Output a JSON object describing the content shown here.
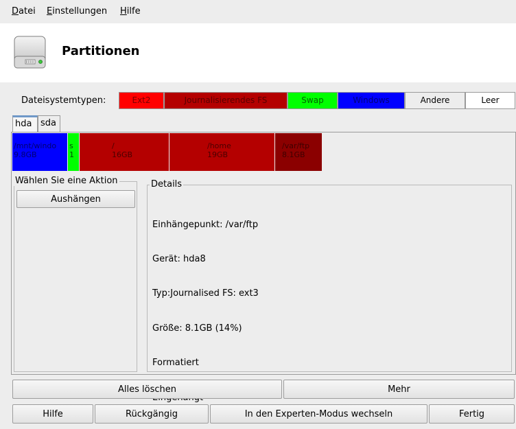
{
  "menu": [
    {
      "mnemonic": "D",
      "rest": "atei"
    },
    {
      "mnemonic": "E",
      "rest": "instellungen"
    },
    {
      "mnemonic": "H",
      "rest": "ilfe"
    }
  ],
  "header": {
    "title": "Partitionen",
    "icon": "hard-disk-icon"
  },
  "legend": {
    "label": "Dateisystemtypen:",
    "items": [
      {
        "label": "Ext2",
        "color": "#ff0000",
        "text_color": "#7a0000"
      },
      {
        "label": "Journalisierendes FS",
        "color": "#b40000",
        "text_color": "#5a0000"
      },
      {
        "label": "Swap",
        "color": "#00ff00",
        "text_color": "#006400"
      },
      {
        "label": "Windows",
        "color": "#0000ff",
        "text_color": "#00007a"
      },
      {
        "label": "Andere",
        "color": "#ededed",
        "text_color": "#000000"
      },
      {
        "label": "Leer",
        "color": "#ffffff",
        "text_color": "#000000"
      }
    ]
  },
  "tabs": [
    {
      "label": "hda",
      "active": true
    },
    {
      "label": "sda",
      "active": false
    }
  ],
  "partitions": [
    {
      "mount": "/mnt/windo",
      "size": "9.8GB",
      "color": "#0000ff",
      "text_color": "#000070"
    },
    {
      "mount": "s",
      "size": "1",
      "color": "#00ff00",
      "text_color": "#005000"
    },
    {
      "mount": "/",
      "size": "16GB",
      "color": "#b40000",
      "text_color": "#4a0000"
    },
    {
      "mount": "/home",
      "size": "19GB",
      "color": "#b40000",
      "text_color": "#4a0000"
    },
    {
      "mount": "/var/ftp",
      "size": "8.1GB",
      "color": "#8b0000",
      "text_color": "#3f0000"
    }
  ],
  "actions": {
    "title": "Wählen Sie eine Aktion",
    "buttons": [
      "Aushängen"
    ]
  },
  "details": {
    "title": "Details",
    "lines": [
      "Einhängepunkt: /var/ftp",
      "Gerät: hda8",
      "Typ:Journalised FS: ext3",
      "Größe: 8.1GB (14%)",
      "Formatiert",
      "Eingehängt"
    ]
  },
  "buttons_row1": {
    "clear_all": "Alles löschen",
    "more": "Mehr"
  },
  "buttons_row2": {
    "help": "Hilfe",
    "undo": "Rückgängig",
    "expert": "In den Experten-Modus wechseln",
    "done": "Fertig"
  }
}
